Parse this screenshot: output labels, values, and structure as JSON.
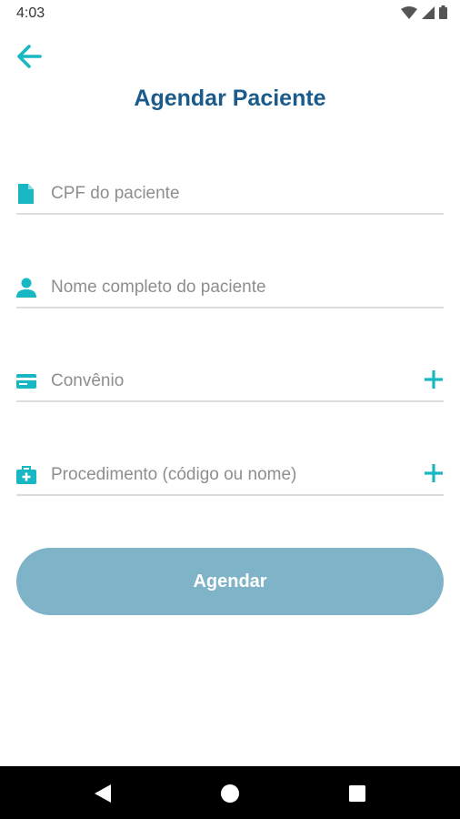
{
  "status_bar": {
    "time": "4:03"
  },
  "header": {
    "title": "Agendar Paciente",
    "back_icon": "arrow-left-icon"
  },
  "form": {
    "cpf": {
      "placeholder": "CPF do paciente",
      "icon": "document-icon",
      "value": ""
    },
    "nome": {
      "placeholder": "Nome completo do paciente",
      "icon": "person-icon",
      "value": ""
    },
    "convenio": {
      "placeholder": "Convênio",
      "icon": "card-icon",
      "value": "",
      "action_icon": "plus-icon"
    },
    "procedimento": {
      "placeholder": "Procedimento (código ou nome)",
      "icon": "medical-kit-icon",
      "value": "",
      "action_icon": "plus-icon"
    }
  },
  "submit": {
    "label": "Agendar"
  },
  "colors": {
    "accent": "#17b8c4",
    "title": "#1a5b8c",
    "button": "#7fb3c8",
    "divider": "#dcdcdc",
    "placeholder": "#8e8e8e"
  }
}
